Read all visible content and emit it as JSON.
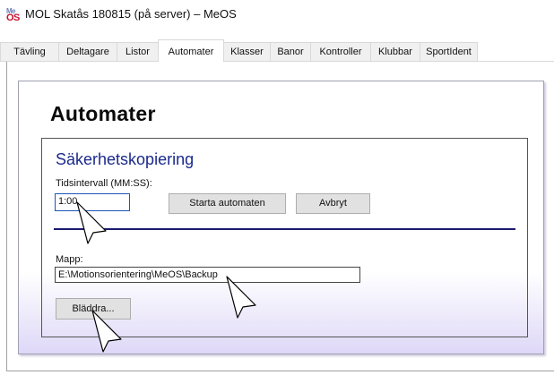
{
  "window": {
    "title": "MOL Skatås 180815 (på server) – MeOS",
    "icon_top": "Me",
    "icon_bottom": "OS"
  },
  "tabs": [
    {
      "label": "Tävling",
      "active": false
    },
    {
      "label": "Deltagare",
      "active": false
    },
    {
      "label": "Listor",
      "active": false
    },
    {
      "label": "Automater",
      "active": true
    },
    {
      "label": "Klasser",
      "active": false
    },
    {
      "label": "Banor",
      "active": false
    },
    {
      "label": "Kontroller",
      "active": false
    },
    {
      "label": "Klubbar",
      "active": false
    },
    {
      "label": "SportIdent",
      "active": false
    }
  ],
  "page": {
    "heading": "Automater"
  },
  "backup": {
    "title": "Säkerhetskopiering",
    "interval_label": "Tidsintervall (MM:SS):",
    "interval_value": "1:00",
    "start_label": "Starta automaten",
    "cancel_label": "Avbryt",
    "folder_label": "Mapp:",
    "folder_value": "E:\\Motionsorientering\\MeOS\\Backup",
    "browse_label": "Bläddra..."
  },
  "colors": {
    "heading_text": "#0a0a0a",
    "group_title": "#1b2a8c",
    "separator": "#1b1b6e",
    "panel_gradient_end": "#ded8f7",
    "icon_me": "#6d7fb8",
    "icon_os": "#c8102e"
  },
  "annotations": [
    "pointer-arrow",
    "pointer-arrow",
    "pointer-arrow"
  ]
}
